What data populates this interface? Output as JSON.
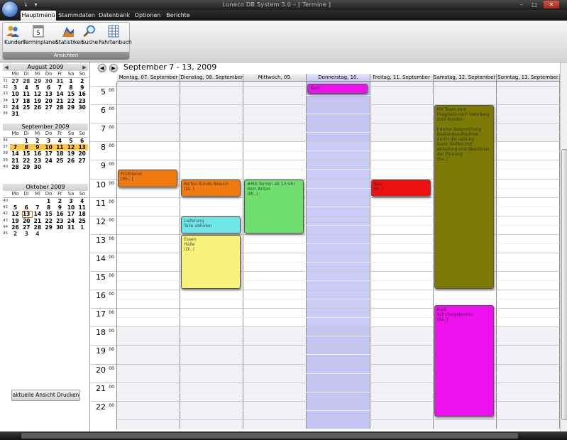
{
  "window": {
    "title": "Luneco DB System 3.0 – [ Termine ]"
  },
  "tabs": [
    "Hauptmenü",
    "Stammdaten",
    "Datenbank",
    "Optionen",
    "Berichte"
  ],
  "ribbon": {
    "buttons": [
      "Kunden",
      "Terminplaner",
      "Statistiken",
      "Suche",
      "Fahrtenbuch"
    ],
    "group_label": "Ansichten",
    "icons": [
      "users-icon",
      "calendar-icon",
      "chart-icon",
      "search-icon",
      "table-icon"
    ]
  },
  "weekday_labels": [
    "Mo",
    "Di",
    "Mi",
    "Do",
    "Fr",
    "Sa",
    "So"
  ],
  "months": [
    {
      "title": "August 2009",
      "weeks": [
        {
          "wk": "31",
          "days": [
            "27",
            "28",
            "29",
            "30",
            "31",
            "1",
            "2"
          ]
        },
        {
          "wk": "32",
          "days": [
            "3",
            "4",
            "5",
            "6",
            "7",
            "8",
            "9"
          ]
        },
        {
          "wk": "33",
          "days": [
            "10",
            "11",
            "12",
            "13",
            "14",
            "15",
            "16"
          ]
        },
        {
          "wk": "34",
          "days": [
            "17",
            "18",
            "19",
            "20",
            "21",
            "22",
            "23"
          ]
        },
        {
          "wk": "35",
          "days": [
            "24",
            "25",
            "26",
            "27",
            "28",
            "29",
            "30"
          ]
        },
        {
          "wk": "36",
          "days": [
            "31",
            "",
            "",
            "",
            "",
            "",
            ""
          ]
        }
      ]
    },
    {
      "title": "September 2009",
      "weeks": [
        {
          "wk": "36",
          "days": [
            "",
            "1",
            "2",
            "3",
            "4",
            "5",
            "6"
          ]
        },
        {
          "wk": "37",
          "days": [
            "7",
            "8",
            "9",
            "10",
            "11",
            "12",
            "13"
          ]
        },
        {
          "wk": "38",
          "days": [
            "14",
            "15",
            "16",
            "17",
            "18",
            "19",
            "20"
          ]
        },
        {
          "wk": "39",
          "days": [
            "21",
            "22",
            "23",
            "24",
            "25",
            "26",
            "27"
          ]
        },
        {
          "wk": "40",
          "days": [
            "28",
            "29",
            "30",
            "",
            "",
            "",
            ""
          ]
        }
      ]
    },
    {
      "title": "Oktober 2009",
      "weeks": [
        {
          "wk": "40",
          "days": [
            "",
            "",
            "",
            "1",
            "2",
            "3",
            "4"
          ]
        },
        {
          "wk": "41",
          "days": [
            "5",
            "6",
            "7",
            "8",
            "9",
            "10",
            "11"
          ]
        },
        {
          "wk": "42",
          "days": [
            "12",
            "13",
            "14",
            "15",
            "16",
            "17",
            "18"
          ]
        },
        {
          "wk": "43",
          "days": [
            "19",
            "20",
            "21",
            "22",
            "23",
            "24",
            "25"
          ]
        },
        {
          "wk": "44",
          "days": [
            "26",
            "27",
            "28",
            "29",
            "30",
            "31",
            "1"
          ]
        },
        {
          "wk": "45",
          "days": [
            "2",
            "3",
            "4",
            "",
            "",
            "",
            ""
          ]
        }
      ]
    }
  ],
  "print_button": "aktuelle Ansicht Drucken",
  "calendar": {
    "range_title": "September 7 - 13, 2009",
    "day_headers": [
      "Montag, 07. September",
      "Dienstag, 08. September",
      "Mittwoch, 09. September",
      "Donnerstag, 10. September",
      "Freitag, 11. September",
      "Samstag, 12. September",
      "Sonntag, 13. September"
    ],
    "selected_day": 3,
    "hours": [
      "5",
      "6",
      "7",
      "8",
      "9",
      "10",
      "11",
      "12",
      "13",
      "14",
      "15",
      "16",
      "17",
      "18",
      "19",
      "20",
      "21",
      "22"
    ],
    "minutes_label": "00",
    "work_start": 8,
    "work_end": 18,
    "appointments": [
      {
        "day": 0,
        "start": 9.5,
        "end": 10.5,
        "color": "#f07a10",
        "lines": [
          "Prüfdienst",
          "[Mo..]"
        ]
      },
      {
        "day": 1,
        "start": 10.0,
        "end": 11.0,
        "color": "#f07a10",
        "lines": [
          "Reifen Kunde Besuch",
          "(Di..)"
        ]
      },
      {
        "day": 1,
        "start": 12.0,
        "end": 13.0,
        "color": "#6fe6ea",
        "lines": [
          "Lieferung",
          "Teile abholen"
        ]
      },
      {
        "day": 1,
        "start": 13.0,
        "end": 16.0,
        "color": "#f7f27a",
        "lines": [
          "Essen",
          "Halle",
          "(Di..)"
        ]
      },
      {
        "day": 2,
        "start": 10.0,
        "end": 13.0,
        "color": "#6ede6e",
        "lines": [
          "#Mit Termin ab 13 Uhr",
          "Herr Anton",
          "(Mi..)"
        ]
      },
      {
        "day": 3,
        "start": 4.85,
        "end": 5.45,
        "color": "#ee11ee",
        "lines": [
          "Kurs"
        ]
      },
      {
        "day": 4,
        "start": 10.0,
        "end": 11.0,
        "color": "#ee1111",
        "lines": [
          "Bau",
          "(Fr..)"
        ]
      },
      {
        "day": 5,
        "start": 6.0,
        "end": 16.0,
        "color": "#7a7a04",
        "lines": [
          "Mit Team zum",
          "Flugplatz nach Hamburg",
          "zum Kunden",
          "",
          "Interne Besprechung",
          "Bestandsaufnahme",
          "durch die Leitung",
          "Dann Treffen mit",
          "Abteilung und Abschluss",
          "der Planung",
          "(Sa..)"
        ]
      },
      {
        "day": 5,
        "start": 16.8,
        "end": 22.9,
        "color": "#ee11ee",
        "lines": [
          "Kurs",
          "Schulungstermin",
          "(Sa..)"
        ]
      }
    ]
  }
}
